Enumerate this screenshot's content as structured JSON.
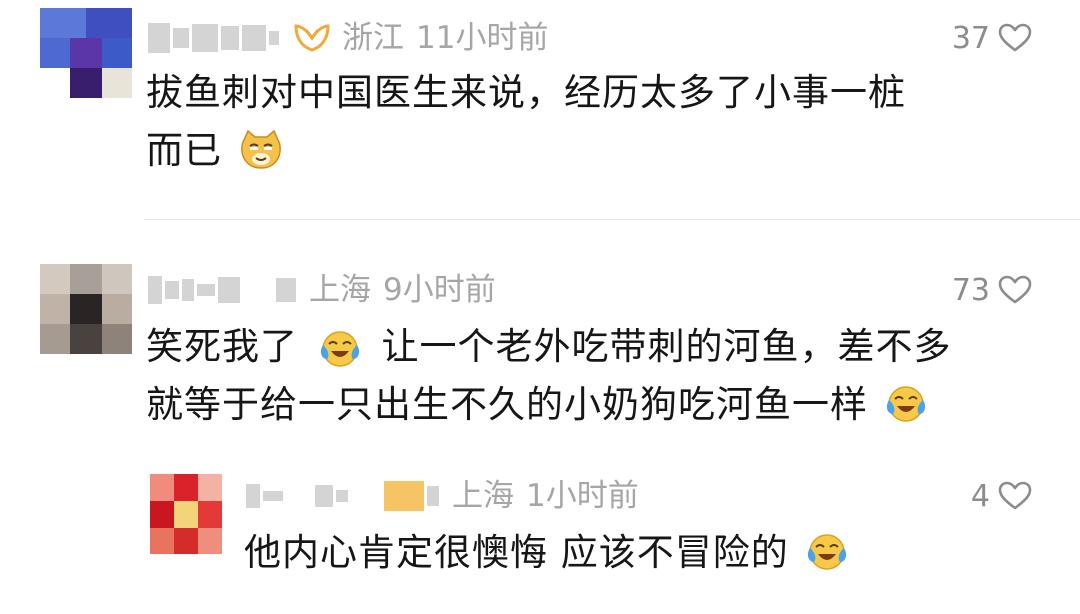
{
  "comments": [
    {
      "location": "浙江",
      "time": "11小时前",
      "likes": "37",
      "line1": "拔鱼刺对中国医生来说，经历太多了小事一桩",
      "line2": "而已",
      "badge_icon": "gold-hollow-badge",
      "emoji": "smug-cat-emoji"
    },
    {
      "location": "上海",
      "time": "9小时前",
      "likes": "73",
      "line1_a": "笑死我了",
      "line1_b": "让一个老外吃带刺的河鱼，差不多",
      "line2": "就等于给一只出生不久的小奶狗吃河鱼一样",
      "emoji": "laughing-tears-emoji"
    },
    {
      "location": "上海",
      "time": "1小时前",
      "likes": "4",
      "line1": "他内心肯定很懊悔 应该不冒险的",
      "emoji": "laughing-tears-emoji"
    }
  ],
  "colors": {
    "meta_text": "#a6a6a6",
    "body_text": "#161616",
    "badge": "#f2a93b",
    "divider": "#e6e6e6"
  }
}
